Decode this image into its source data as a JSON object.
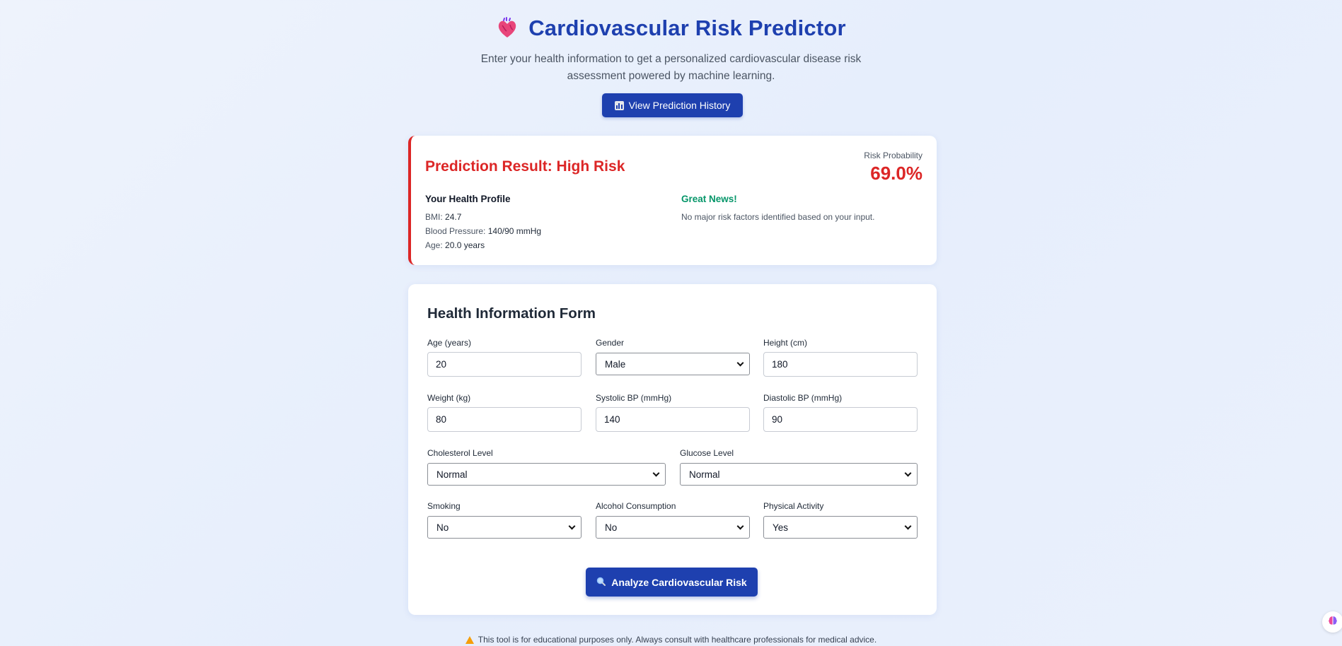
{
  "header": {
    "title": "Cardiovascular Risk Predictor",
    "subtitle": "Enter your health information to get a personalized cardiovascular disease risk assessment powered by machine learning.",
    "history_button": "View Prediction History"
  },
  "result": {
    "title": "Prediction Result: High Risk",
    "risk_label": "Risk Probability",
    "risk_value": "69.0%",
    "profile_title": "Your Health Profile",
    "bmi_label": "BMI:",
    "bmi_value": "24.7",
    "bp_label": "Blood Pressure:",
    "bp_value": "140/90 mmHg",
    "age_label": "Age:",
    "age_value": "20.0 years",
    "news_title": "Great News!",
    "news_text": "No major risk factors identified based on your input."
  },
  "form": {
    "title": "Health Information Form",
    "fields": {
      "age": {
        "label": "Age (years)",
        "value": "20"
      },
      "gender": {
        "label": "Gender",
        "value": "Male"
      },
      "height": {
        "label": "Height (cm)",
        "value": "180"
      },
      "weight": {
        "label": "Weight (kg)",
        "value": "80"
      },
      "systolic": {
        "label": "Systolic BP (mmHg)",
        "value": "140"
      },
      "diastolic": {
        "label": "Diastolic BP (mmHg)",
        "value": "90"
      },
      "cholesterol": {
        "label": "Cholesterol Level",
        "value": "Normal"
      },
      "glucose": {
        "label": "Glucose Level",
        "value": "Normal"
      },
      "smoking": {
        "label": "Smoking",
        "value": "No"
      },
      "alcohol": {
        "label": "Alcohol Consumption",
        "value": "No"
      },
      "activity": {
        "label": "Physical Activity",
        "value": "Yes"
      }
    },
    "submit_label": "Analyze Cardiovascular Risk"
  },
  "disclaimer": "This tool is for educational purposes only. Always consult with healthcare professionals for medical advice.",
  "colors": {
    "primary": "#1e40af",
    "danger": "#dc2626",
    "success": "#059669"
  }
}
